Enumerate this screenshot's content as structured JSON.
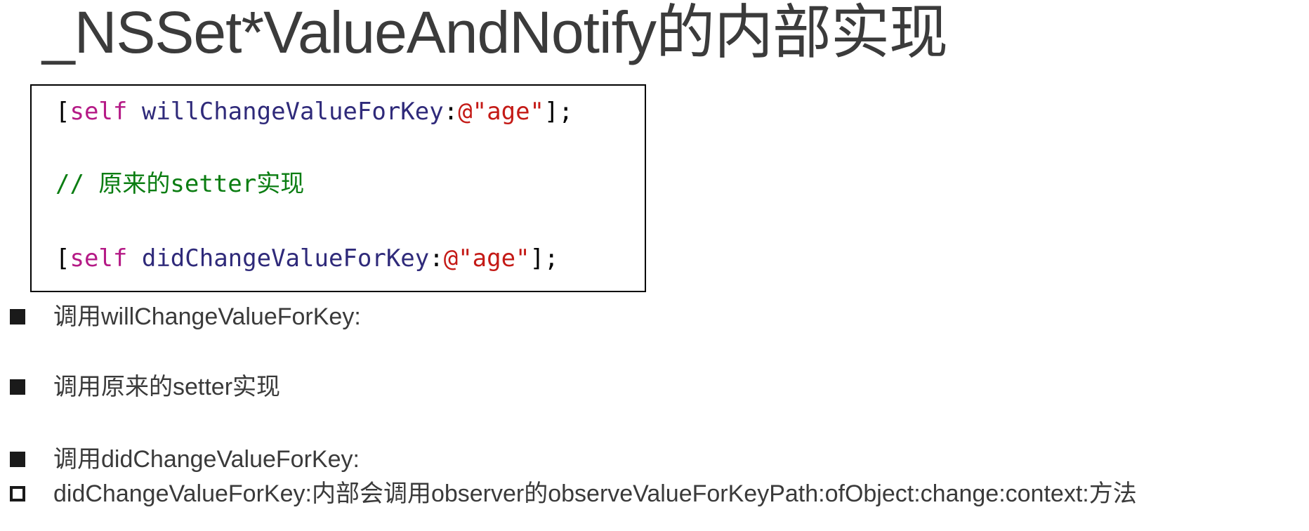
{
  "slide": {
    "title": "_NSSet*ValueAndNotify的内部实现"
  },
  "code_block": {
    "line1": {
      "open_bracket": "[",
      "keyword": "self",
      "method": " willChangeValueForKey",
      "colon": ":",
      "string": "@\"age\"",
      "close": "];"
    },
    "line2": {
      "comment": "// 原来的setter实现"
    },
    "line3": {
      "open_bracket": "[",
      "keyword": "self",
      "method": " didChangeValueForKey",
      "colon": ":",
      "string": "@\"age\"",
      "close": "];"
    },
    "colors": {
      "keyword": "#b51a86",
      "method": "#2f2a7a",
      "string": "#c41a16",
      "comment": "#0b7d12"
    }
  },
  "bullets": [
    {
      "marker": "filled-square-icon",
      "text": "调用willChangeValueForKey:"
    },
    {
      "marker": "filled-square-icon",
      "text": "调用原来的setter实现"
    },
    {
      "marker": "filled-square-icon",
      "text": "调用didChangeValueForKey:"
    },
    {
      "marker": "hollow-square-icon",
      "text": "didChangeValueForKey:内部会调用observer的observeValueForKeyPath:ofObject:change:context:方法"
    }
  ]
}
